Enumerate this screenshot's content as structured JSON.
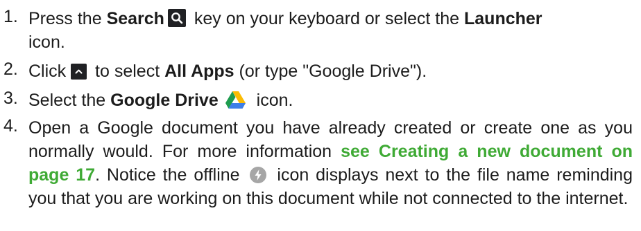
{
  "steps": [
    {
      "number": "1.",
      "parts": [
        "Press the ",
        "Search",
        " key on your keyboard or select the ",
        "Launcher",
        " icon."
      ]
    },
    {
      "number": "2.",
      "parts": [
        "Click ",
        " to select ",
        "All Apps",
        " (or type \"Google Drive\")."
      ]
    },
    {
      "number": "3.",
      "parts": [
        "Select the ",
        "Google Drive",
        " icon."
      ]
    },
    {
      "number": "4.",
      "parts": [
        "Open a Google document you have already created or create one as you normally would. For more information ",
        "see Creating a new document on page 17",
        ". Notice the offline ",
        " icon displays next to the file name reminding you that you are working on this document while not connected to the internet."
      ]
    }
  ],
  "icons": {
    "search": "search-key-icon",
    "launcher": "launcher-up-arrow-icon",
    "drive": "google-drive-icon",
    "offline": "offline-bolt-icon"
  },
  "colors": {
    "link": "#3faa35",
    "text": "#1c1c1c",
    "key_bg": "#202124"
  }
}
